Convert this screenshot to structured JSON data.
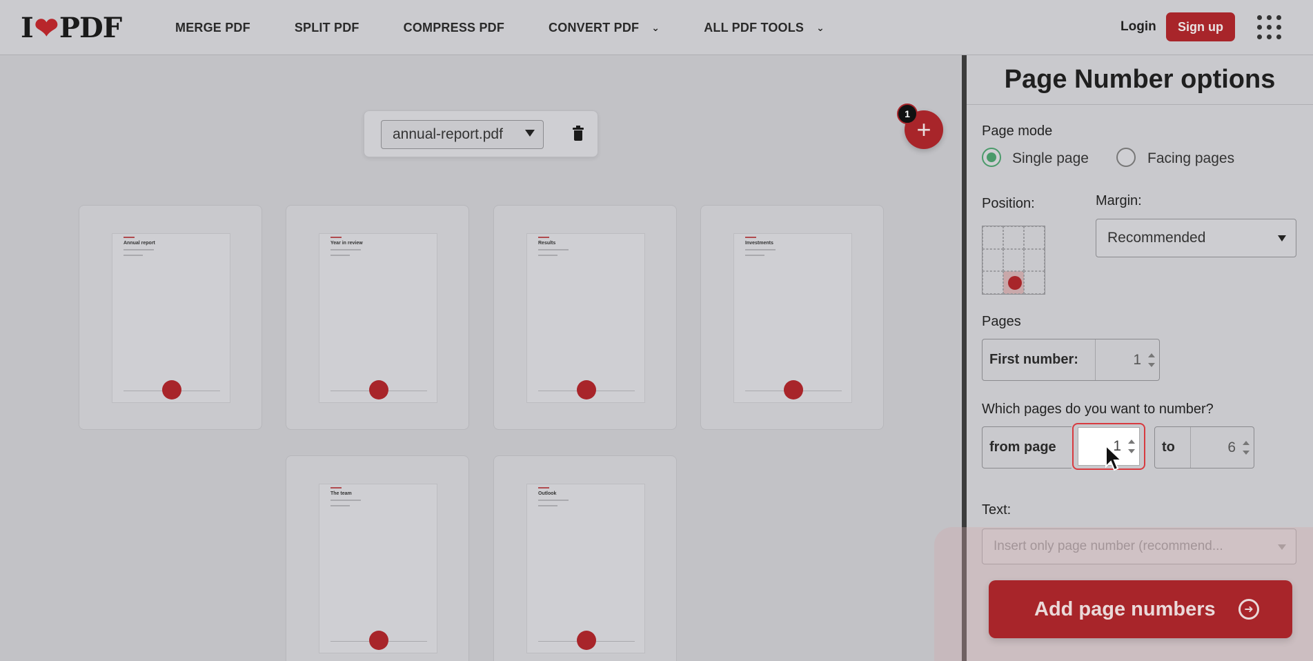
{
  "header": {
    "logo": {
      "left": "I",
      "right": "PDF"
    },
    "nav": [
      {
        "label": "MERGE PDF",
        "dropdown": false
      },
      {
        "label": "SPLIT PDF",
        "dropdown": false
      },
      {
        "label": "COMPRESS PDF",
        "dropdown": false
      },
      {
        "label": "CONVERT PDF",
        "dropdown": true
      },
      {
        "label": "ALL PDF TOOLS",
        "dropdown": true
      }
    ],
    "login": "Login",
    "signup": "Sign up"
  },
  "workspace": {
    "file_name": "annual-report.pdf",
    "file_count_badge": "1",
    "add_icon": "plus-icon",
    "pages": [
      {
        "title": "Annual report"
      },
      {
        "title": "Year in review"
      },
      {
        "title": "Results"
      },
      {
        "title": "Investments"
      },
      {
        "title": "The team"
      },
      {
        "title": "Outlook"
      }
    ]
  },
  "panel": {
    "title": "Page Number options",
    "page_mode_label": "Page mode",
    "mode_single": "Single page",
    "mode_facing": "Facing pages",
    "selected_mode": "Single page",
    "position_label": "Position:",
    "selected_position": "bottom-center",
    "margin_label": "Margin:",
    "margin_value": "Recommended",
    "pages_label": "Pages",
    "first_number_label": "First number:",
    "first_number_value": "1",
    "which_pages_label": "Which pages do you want to number?",
    "from_page_label": "from page",
    "from_page_value": "1",
    "to_label": "to",
    "to_value": "6",
    "text_label": "Text:",
    "text_placeholder": "Insert only page number (recommend...",
    "cta_label": "Add page numbers"
  },
  "colors": {
    "brand_red": "#a8252a",
    "radio_green": "#4a9a6a",
    "focus_red": "#d83a3f"
  }
}
